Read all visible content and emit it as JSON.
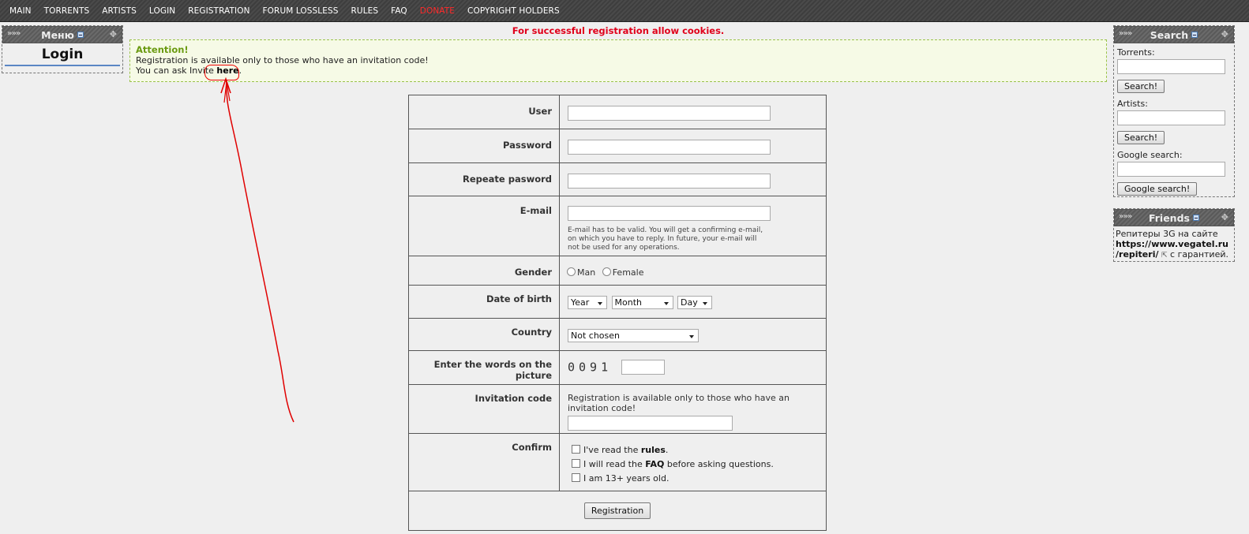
{
  "nav": {
    "items": [
      "MAIN",
      "TORRENTS",
      "ARTISTS",
      "LOGIN",
      "REGISTRATION",
      "FORUM LOSSLESS",
      "RULES",
      "FAQ",
      "DONATE",
      "COPYRIGHT HOLDERS"
    ],
    "highlight_color": "#ff2a2a"
  },
  "left_block": {
    "title": "Меню",
    "login_label": "Login"
  },
  "notice": {
    "cookies": "For successful registration allow cookies.",
    "attention_title": "Attention!",
    "line1": "Registration is available only to those who have an invitation code!",
    "line2_prefix": "You can ask Invite ",
    "line2_link": "here",
    "line2_suffix": "."
  },
  "form": {
    "user_label": "User",
    "password_label": "Password",
    "repeat_label": "Repeate pasword",
    "email_label": "E-mail",
    "email_note": "E-mail has to be valid. You will get a confirming e-mail, on which you have to reply. In future, your e-mail will not be used for any operations.",
    "gender_label": "Gender",
    "gender_options": [
      "Man",
      "Female"
    ],
    "dob_label": "Date of birth",
    "dob_year": "Year",
    "dob_month": "Month",
    "dob_day": "Day",
    "country_label": "Country",
    "country_value": "Not chosen",
    "captcha_label": "Enter the words on the picture",
    "captcha_text": "0091",
    "invite_label": "Invitation code",
    "invite_note": "Registration is available only to those who have an invitation code!",
    "confirm_label": "Confirm",
    "confirm_1_pre": "I've read the ",
    "confirm_1_bold": "rules",
    "confirm_1_post": ".",
    "confirm_2_pre": "I will read the ",
    "confirm_2_bold": "FAQ",
    "confirm_2_post": " before asking questions.",
    "confirm_3": "I am 13+ years old.",
    "submit": "Registration"
  },
  "search_block": {
    "title": "Search",
    "torrents_label": "Torrents:",
    "artists_label": "Artists:",
    "google_label": "Google search:",
    "search_btn": "Search!",
    "google_btn": "Google search!"
  },
  "friends_block": {
    "title": "Friends",
    "text1": "Репитеры 3G на сайте",
    "link1": "https://www.vegatel.ru",
    "link2": "/repiteri/",
    "text2": " с гарантией."
  },
  "annotation_color": "#e00000"
}
